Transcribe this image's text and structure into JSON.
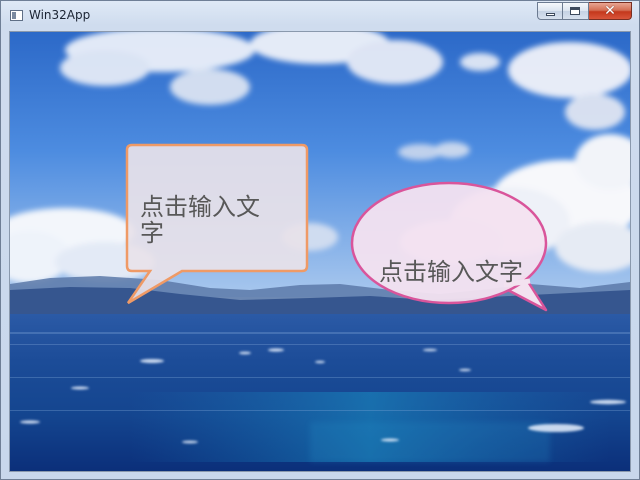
{
  "window": {
    "title": "Win32App",
    "icons": {
      "app": "app-window-icon",
      "minimize": "minimize-icon",
      "maximize": "maximize-icon",
      "close": "close-icon"
    },
    "close_glyph": "✕"
  },
  "bubbles": {
    "rect": {
      "text": "点击输入文字",
      "fill": "#e8e2e9",
      "stroke": "#ef9a66"
    },
    "ellipse": {
      "text": "点击输入文字",
      "fill": "#f3e2f0",
      "stroke": "#d9559b"
    }
  },
  "colors": {
    "sky_top": "#2f6fcf",
    "sky_bottom": "#8bb7ea",
    "sea_top": "#1e4f9a",
    "sea_bottom": "#0a2f76",
    "mountain": "#3f5f98",
    "close_button": "#c7452a"
  }
}
